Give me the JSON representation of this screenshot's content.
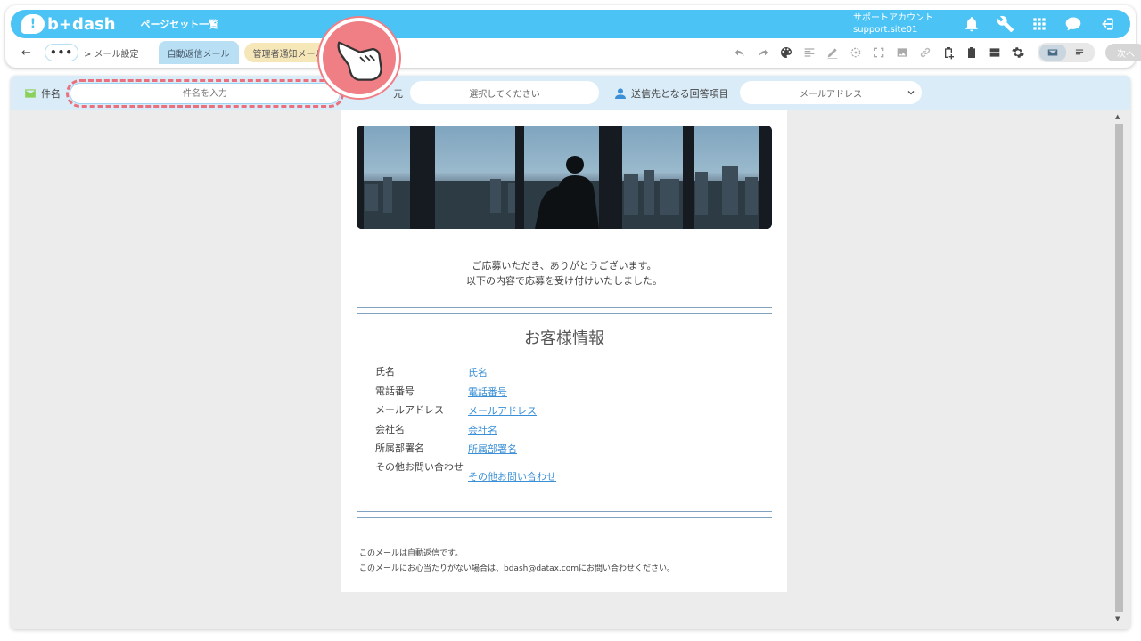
{
  "header": {
    "logo_text": "b+dash",
    "page_list_label": "ページセット一覧",
    "account_line1": "サポートアカウント",
    "account_line2": "support.site01",
    "icons": [
      "bell-icon",
      "wrench-icon",
      "grid-icon",
      "chat-icon",
      "logout-icon"
    ]
  },
  "subnav": {
    "back_label": "←",
    "more_label": "•••",
    "breadcrumb": "> メール設定",
    "tabs": [
      {
        "label": "自動返信メール",
        "active": true
      },
      {
        "label": "管理者通知メール",
        "active": false
      }
    ],
    "next_label": "次へ"
  },
  "fields": {
    "subject_label": "件名",
    "subject_placeholder": "件名を入力",
    "sender_label": "元",
    "sender_value": "選択してください",
    "recipient_label": "送信先となる回答項目",
    "recipient_value": "メールアドレス"
  },
  "mail": {
    "greeting_line1": "ご応募いただき、ありがとうございます。",
    "greeting_line2": "以下の内容で応募を受け付けいたしました。",
    "section_title": "お客様情報",
    "rows": [
      {
        "key": "氏名",
        "value": "氏名"
      },
      {
        "key": "電話番号",
        "value": "電話番号"
      },
      {
        "key": "メールアドレス",
        "value": "メールアドレス"
      },
      {
        "key": "会社名",
        "value": "会社名"
      },
      {
        "key": "所属部署名",
        "value": "所属部署名"
      },
      {
        "key": "その他お問い合わせ",
        "value": "その他お問い合わせ"
      }
    ],
    "footer_line1": "このメールは自動返信です。",
    "footer_line2": "このメールにお心当たりがない場合は、bdash@datax.comにお問い合わせください。"
  },
  "colors": {
    "brand": "#4cc3f5",
    "highlight": "#e9707c",
    "link": "#3a8fd6"
  }
}
